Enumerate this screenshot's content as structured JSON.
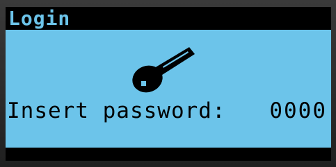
{
  "screen": {
    "title": "Login",
    "icon": "key-icon",
    "prompt_label": "Insert password:",
    "password_value": "0000"
  },
  "colors": {
    "screen_background": "#6cc4ea",
    "bar": "#000000",
    "text": "#000000"
  }
}
